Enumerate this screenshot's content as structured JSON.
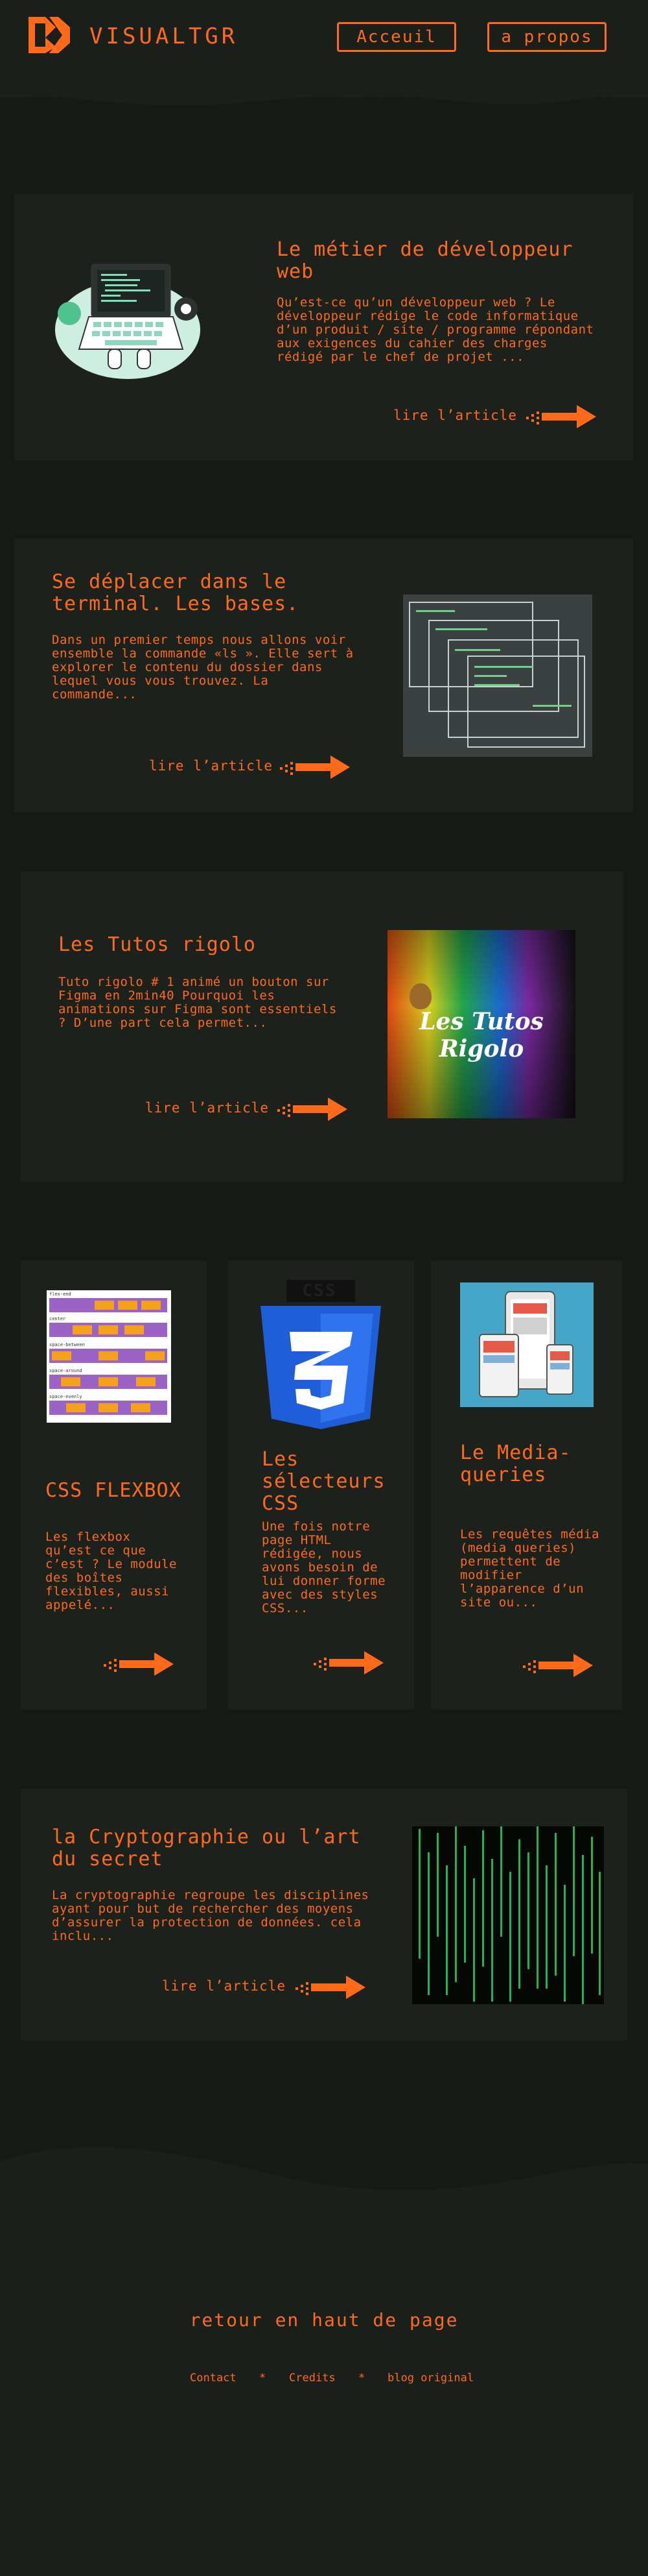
{
  "header": {
    "brand": "VISUALTGR",
    "nav": [
      {
        "label": "Acceuil"
      },
      {
        "label": "a propos"
      }
    ]
  },
  "articles": [
    {
      "title": "Le métier de développeur web",
      "text": "Qu’est-ce qu’un développeur web ? Le développeur rédige le code informatique d’un produit / site / programme répondant aux exigences du cahier des charges rédigé par le chef de projet ...",
      "read": "lire l’article"
    },
    {
      "title": "Se déplacer dans le terminal. Les bases.",
      "text": "Dans un premier temps nous allons voir ensemble la commande «ls ». Elle sert à explorer le contenu du dossier dans lequel vous vous trouvez. La commande...",
      "read": "lire l’article"
    },
    {
      "title": "Les Tutos rigolo",
      "text": "Tuto rigolo # 1 animé un bouton sur Figma en 2min40 Pourquoi les animations sur Figma sont essentiels ? D’une part cela permet...",
      "read": "lire l’article",
      "image_text": "Les Tutos Rigolo"
    },
    {
      "title": "la Cryptographie ou l’art du secret",
      "text": "La cryptographie regroupe les disciplines ayant pour but de rechercher des moyens d’assurer la protection de données. cela inclu...",
      "read": "lire l’article"
    }
  ],
  "small_cards": [
    {
      "title": "CSS FLEXBOX",
      "text": "Les flexbox qu’est ce que c’est ? Le module des boîtes flexibles, aussi appelé...",
      "image_labels": [
        "flex-end",
        "center",
        "space-between",
        "space-around",
        "space-evenly"
      ]
    },
    {
      "title": "Les sélecteurs CSS",
      "text": "Une fois notre page HTML rédigée, nous avons besoin de lui donner forme avec des styles CSS...",
      "image_text": "CSS"
    },
    {
      "title": "Le Media-queries",
      "text": "Les requêtes média (media queries) permettent de modifier l’apparence d’un site ou..."
    }
  ],
  "footer": {
    "back_to_top": "retour en haut de page",
    "links": [
      "Contact",
      "Credits",
      "blog original"
    ],
    "separator": "*"
  },
  "colors": {
    "background": "#161a15",
    "card": "#1d211c",
    "accent": "#ff6a1a"
  }
}
